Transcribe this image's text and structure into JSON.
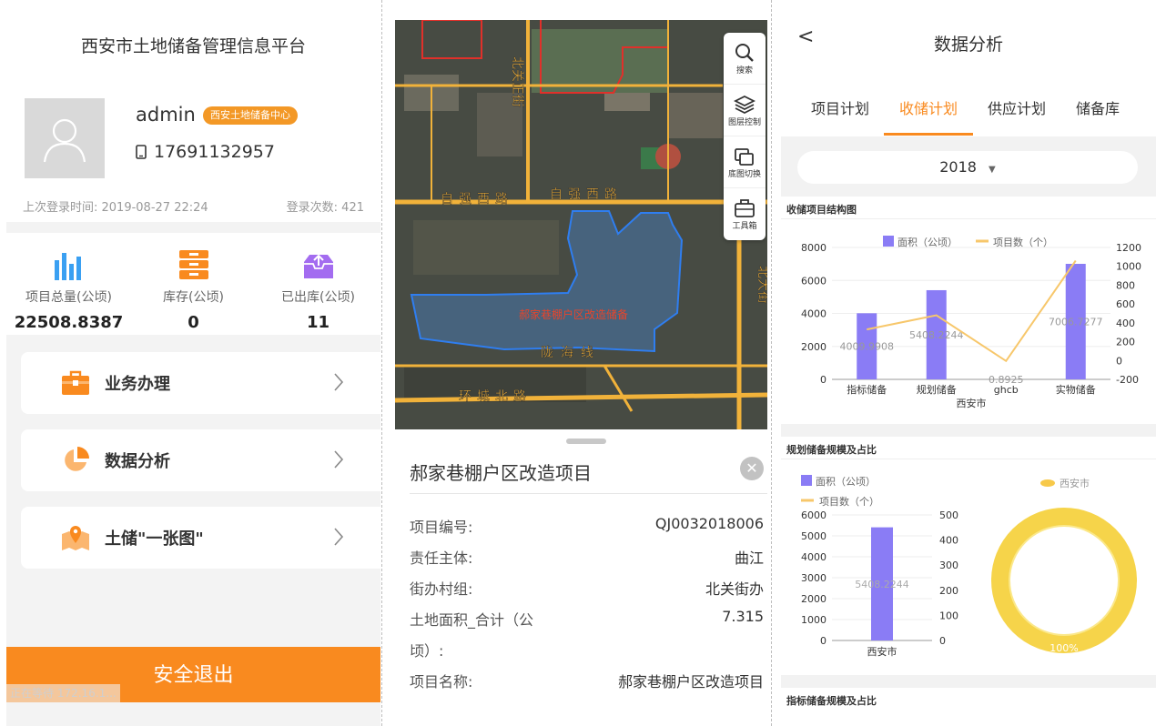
{
  "profile": {
    "app_title": "西安市土地储备管理信息平台",
    "username": "admin",
    "org_badge": "西安土地储备中心",
    "phone": "17691132957",
    "last_login": "上次登录时间:  2019-08-27 22:24",
    "login_count": "登录次数:  421",
    "stats": [
      {
        "label": "项目总量(公顷)",
        "value": "22508.8387",
        "icon": "bar-chart-icon",
        "color": "#3aa0f2"
      },
      {
        "label": "库存(公顷)",
        "value": "0",
        "icon": "cabinet-icon",
        "color": "#f98a1f"
      },
      {
        "label": "已出库(公顷)",
        "value": "11",
        "icon": "outbox-icon",
        "color": "#a36cf0"
      }
    ],
    "menu": [
      {
        "label": "业务办理",
        "icon": "briefcase-icon"
      },
      {
        "label": "数据分析",
        "icon": "pie-chart-icon"
      },
      {
        "label": "土储\"一张图\"",
        "icon": "map-icon"
      }
    ],
    "logout_label": "安全退出",
    "status_text": "正在等待 172.16.1..."
  },
  "map": {
    "tools": [
      {
        "label": "搜索",
        "icon": "search-icon"
      },
      {
        "label": "图层控制",
        "icon": "layers-icon"
      },
      {
        "label": "底图切换",
        "icon": "basemap-icon"
      },
      {
        "label": "工具箱",
        "icon": "toolbox-icon"
      }
    ],
    "road_labels": [
      "自强西路",
      "自强西路",
      "北关正街",
      "陇海线",
      "环城北路",
      "北大街"
    ],
    "parcel_label": "郝家巷棚户区改造储备",
    "detail": {
      "title": "郝家巷棚户区改造项目",
      "rows": [
        {
          "key": "项目编号:",
          "value": "QJ0032018006"
        },
        {
          "key": "责任主体:",
          "value": "曲江"
        },
        {
          "key": "街办村组:",
          "value": "北关街办"
        },
        {
          "key": "土地面积_合计（公",
          "value": "7.315"
        },
        {
          "key": "顷）:",
          "value": ""
        },
        {
          "key": "项目名称:",
          "value": "郝家巷棚户区改造项目"
        }
      ]
    }
  },
  "analysis": {
    "back_label": "<",
    "title": "数据分析",
    "tabs": [
      "项目计划",
      "收储计划",
      "供应计划",
      "储备库"
    ],
    "active_tab": "收储计划",
    "year": "2018",
    "section_titles": [
      "收储项目结构图",
      "规划储备规模及占比",
      "指标储备规模及占比"
    ],
    "legend_area": "面积（公顷）",
    "legend_count": "项目数（个）",
    "pie_legend": "西安市",
    "pie_label": "100%",
    "colors": {
      "bar": "#8a7cf5",
      "line": "#f7c76b",
      "accent": "#f98a1f"
    }
  },
  "chart_data": [
    {
      "type": "bar",
      "title": "收储项目结构图",
      "categories": [
        "指标储备",
        "规划储备",
        "ghcb",
        "实物储备"
      ],
      "group_label": "西安市",
      "series": [
        {
          "name": "面积（公顷）",
          "values": [
            4009.9908,
            5408.2244,
            0.8925,
            7006.7277
          ],
          "axis": "left",
          "kind": "bar",
          "labels": [
            "4009.9908",
            "5408.2244",
            "0.8925",
            "7006.7277"
          ]
        },
        {
          "name": "项目数（个）",
          "values": [
            330,
            480,
            -5,
            1060
          ],
          "axis": "right",
          "kind": "line"
        }
      ],
      "ylim": [
        0,
        8000
      ],
      "yticks": [
        "0",
        "2000",
        "4000",
        "6000",
        "8000"
      ],
      "y2lim": [
        -200,
        1200
      ],
      "y2ticks": [
        "-200",
        "0",
        "200",
        "400",
        "600",
        "800",
        "1000",
        "1200"
      ],
      "legend": "top"
    },
    {
      "type": "bar",
      "title": "规划储备规模及占比",
      "categories": [
        "西安市"
      ],
      "series": [
        {
          "name": "面积（公顷）",
          "values": [
            5408.2244
          ],
          "axis": "left",
          "kind": "bar",
          "labels": [
            "5408.2244"
          ]
        },
        {
          "name": "项目数（个）",
          "values": [
            0
          ],
          "axis": "right",
          "kind": "line"
        }
      ],
      "ylim": [
        0,
        6000
      ],
      "yticks": [
        "0",
        "1000",
        "2000",
        "3000",
        "4000",
        "5000",
        "6000"
      ],
      "y2lim": [
        0,
        500
      ],
      "y2ticks": [
        "0",
        "100",
        "200",
        "300",
        "400",
        "500"
      ],
      "legend": "top-left"
    },
    {
      "type": "pie",
      "title": "规划储备规模及占比",
      "slices": [
        {
          "name": "西安市",
          "value": 100
        }
      ],
      "labels": [
        "100%"
      ],
      "legend": "top-right"
    }
  ]
}
